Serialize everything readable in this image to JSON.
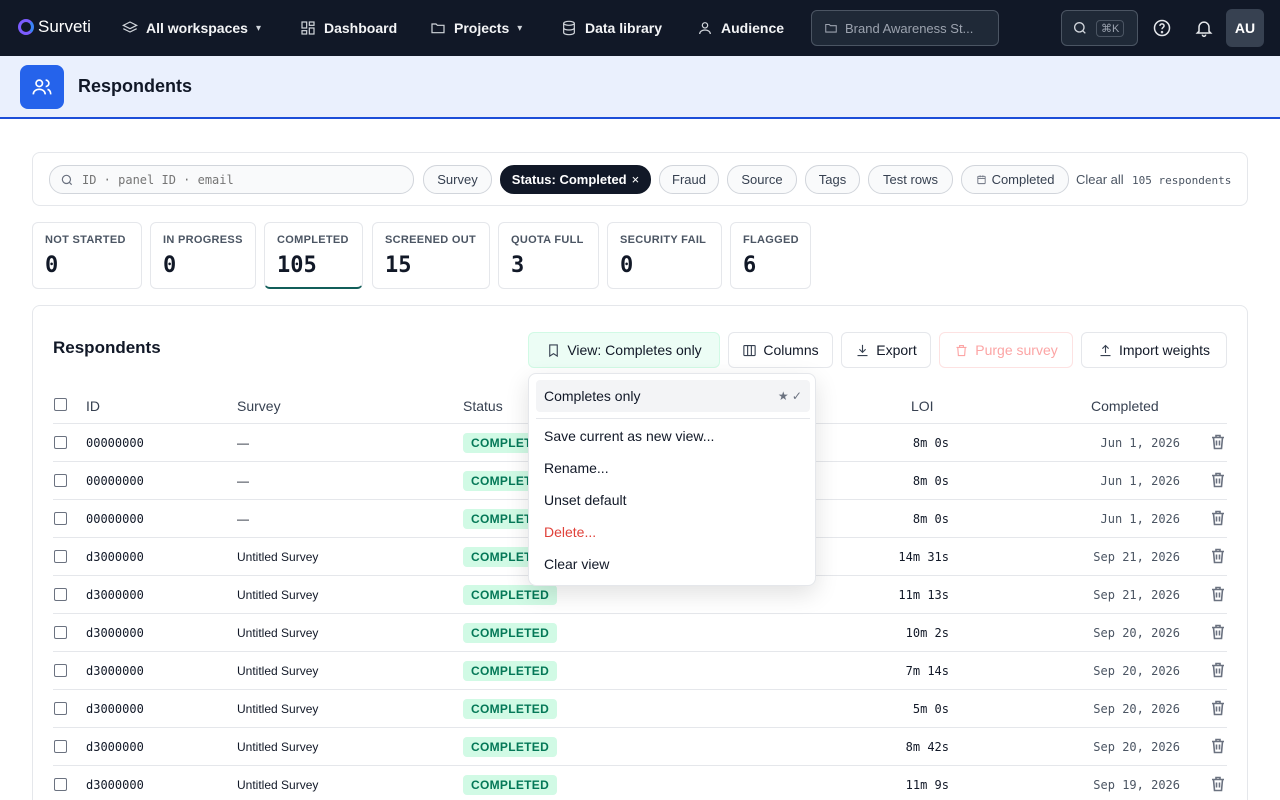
{
  "app": {
    "brand": "Surveti"
  },
  "nav": {
    "workspace": "All workspaces",
    "items": [
      {
        "label": "Dashboard",
        "icon": "dashboard-icon"
      },
      {
        "label": "Projects",
        "icon": "folder-icon"
      },
      {
        "label": "Data library",
        "icon": "database-icon"
      },
      {
        "label": "Audience",
        "icon": "user-icon"
      }
    ],
    "breadcrumb": "Brand Awareness St...",
    "search_shortcut": "⌘K",
    "avatar": "AU"
  },
  "page": {
    "title": "Respondents"
  },
  "filters": {
    "search_placeholder": "ID · panel ID · email",
    "chips": [
      "Survey",
      "Status: Completed",
      "Fraud",
      "Source",
      "Tags",
      "Test rows",
      "Completed"
    ],
    "clear_all": "Clear all",
    "count": "105 respondents"
  },
  "stats": [
    {
      "label": "NOT STARTED",
      "value": "0"
    },
    {
      "label": "IN PROGRESS",
      "value": "0"
    },
    {
      "label": "COMPLETED",
      "value": "105"
    },
    {
      "label": "SCREENED OUT",
      "value": "15"
    },
    {
      "label": "QUOTA FULL",
      "value": "3"
    },
    {
      "label": "SECURITY FAIL",
      "value": "0"
    },
    {
      "label": "FLAGGED",
      "value": "6"
    }
  ],
  "table": {
    "title": "Respondents",
    "toolbar": {
      "view": "View: Completes only",
      "columns": "Columns",
      "export": "Export",
      "purge": "Purge survey",
      "import": "Import weights"
    },
    "headers": {
      "id": "ID",
      "survey": "Survey",
      "status": "Status",
      "loi": "LOI",
      "completed": "Completed"
    },
    "rows": [
      {
        "id": "00000000",
        "survey": "—",
        "status": "COMPLETED",
        "loi": "8m 0s",
        "completed": "Jun 1, 2026"
      },
      {
        "id": "00000000",
        "survey": "—",
        "status": "COMPLETED",
        "loi": "8m 0s",
        "completed": "Jun 1, 2026"
      },
      {
        "id": "00000000",
        "survey": "—",
        "status": "COMPLETED",
        "loi": "8m 0s",
        "completed": "Jun 1, 2026"
      },
      {
        "id": "d3000000",
        "survey": "Untitled Survey",
        "status": "COMPLETED",
        "loi": "14m 31s",
        "completed": "Sep 21, 2026"
      },
      {
        "id": "d3000000",
        "survey": "Untitled Survey",
        "status": "COMPLETED",
        "loi": "11m 13s",
        "completed": "Sep 21, 2026"
      },
      {
        "id": "d3000000",
        "survey": "Untitled Survey",
        "status": "COMPLETED",
        "loi": "10m 2s",
        "completed": "Sep 20, 2026"
      },
      {
        "id": "d3000000",
        "survey": "Untitled Survey",
        "status": "COMPLETED",
        "loi": "7m 14s",
        "completed": "Sep 20, 2026"
      },
      {
        "id": "d3000000",
        "survey": "Untitled Survey",
        "status": "COMPLETED",
        "loi": "5m 0s",
        "completed": "Sep 20, 2026"
      },
      {
        "id": "d3000000",
        "survey": "Untitled Survey",
        "status": "COMPLETED",
        "loi": "8m 42s",
        "completed": "Sep 20, 2026"
      },
      {
        "id": "d3000000",
        "survey": "Untitled Survey",
        "status": "COMPLETED",
        "loi": "11m 9s",
        "completed": "Sep 19, 2026"
      }
    ]
  },
  "view_menu": {
    "active": "Completes only",
    "active_marks": "★ ✓",
    "items": [
      "Save current as new view...",
      "Rename...",
      "Unset default",
      "Delete...",
      "Clear view"
    ]
  },
  "colors": {
    "accent": "#2563eb",
    "nav_bg": "#111827",
    "badge_bg": "#d1fae5",
    "badge_text": "#047857",
    "danger": "#e0413a"
  }
}
